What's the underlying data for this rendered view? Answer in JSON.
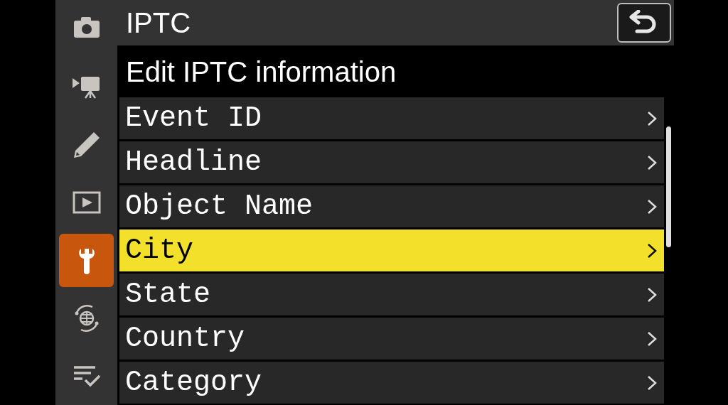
{
  "header": {
    "title": "IPTC"
  },
  "subtitle": "Edit IPTC information",
  "sidebar": {
    "items": [
      {
        "kind": "photo",
        "selected": false
      },
      {
        "kind": "movie",
        "selected": false
      },
      {
        "kind": "retouch",
        "selected": false
      },
      {
        "kind": "playback",
        "selected": false
      },
      {
        "kind": "setup",
        "selected": true
      },
      {
        "kind": "network",
        "selected": false
      },
      {
        "kind": "mymenu",
        "selected": false
      }
    ]
  },
  "list": {
    "items": [
      {
        "label": "Event ID",
        "selected": false
      },
      {
        "label": "Headline",
        "selected": false
      },
      {
        "label": "Object Name",
        "selected": false
      },
      {
        "label": "City",
        "selected": true
      },
      {
        "label": "State",
        "selected": false
      },
      {
        "label": "Country",
        "selected": false
      },
      {
        "label": "Category",
        "selected": false
      }
    ]
  }
}
